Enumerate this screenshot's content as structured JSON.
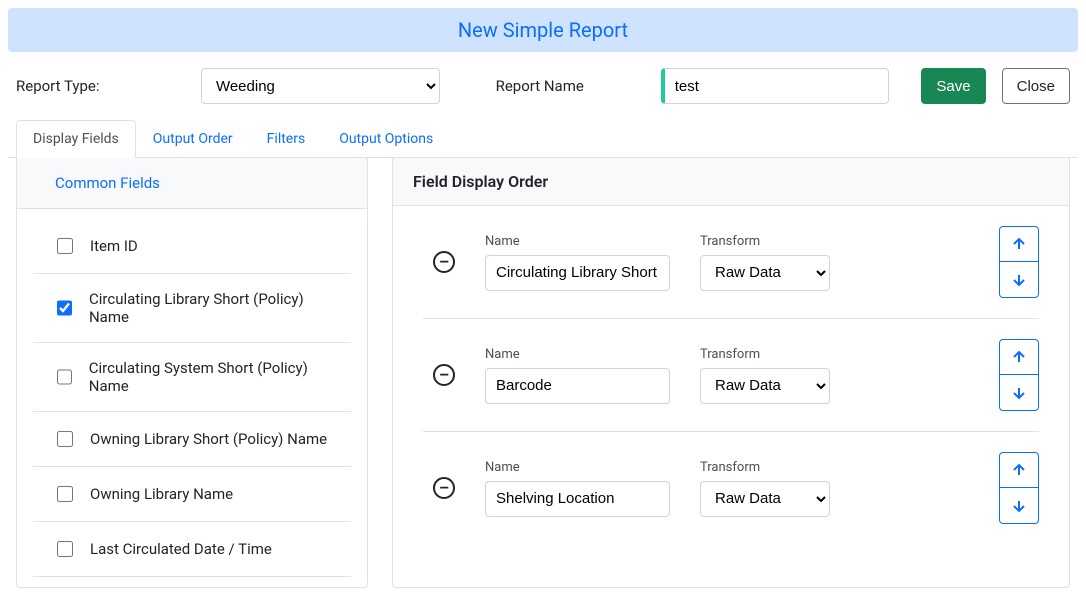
{
  "header": {
    "title": "New Simple Report"
  },
  "form": {
    "report_type_label": "Report Type:",
    "report_type_value": "Weeding",
    "report_name_label": "Report Name",
    "report_name_value": "test",
    "save_label": "Save",
    "close_label": "Close"
  },
  "tabs": [
    {
      "label": "Display Fields",
      "active": true
    },
    {
      "label": "Output Order",
      "active": false
    },
    {
      "label": "Filters",
      "active": false
    },
    {
      "label": "Output Options",
      "active": false
    }
  ],
  "left": {
    "header": "Common Fields",
    "items": [
      {
        "label": "Item ID",
        "checked": false
      },
      {
        "label": "Circulating Library Short (Policy) Name",
        "checked": true
      },
      {
        "label": "Circulating System Short (Policy) Name",
        "checked": false
      },
      {
        "label": "Owning Library Short (Policy) Name",
        "checked": false
      },
      {
        "label": "Owning Library Name",
        "checked": false
      },
      {
        "label": "Last Circulated Date / Time",
        "checked": false
      }
    ]
  },
  "right": {
    "header": "Field Display Order",
    "name_label": "Name",
    "transform_label": "Transform",
    "rows": [
      {
        "name": "Circulating Library Short (",
        "transform": "Raw Data"
      },
      {
        "name": "Barcode",
        "transform": "Raw Data"
      },
      {
        "name": "Shelving Location",
        "transform": "Raw Data"
      }
    ]
  }
}
